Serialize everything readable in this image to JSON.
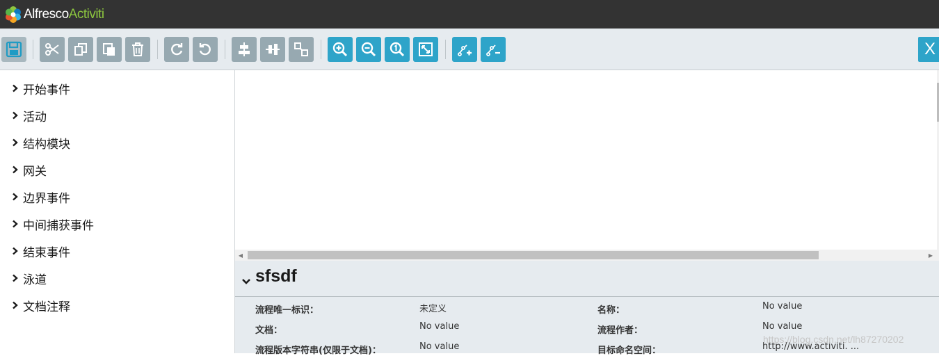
{
  "header": {
    "brand": "Alfresco",
    "product": "Activiti"
  },
  "toolbar": {
    "buttons": [
      {
        "icon": "save-icon",
        "style": "gray-light"
      },
      {
        "icon": "cut-icon",
        "style": "gray"
      },
      {
        "icon": "copy-icon",
        "style": "gray"
      },
      {
        "icon": "paste-icon",
        "style": "gray"
      },
      {
        "icon": "delete-icon",
        "style": "gray"
      },
      {
        "icon": "redo-icon",
        "style": "gray"
      },
      {
        "icon": "undo-icon",
        "style": "gray"
      },
      {
        "icon": "align-vertical-icon",
        "style": "gray"
      },
      {
        "icon": "align-horizontal-icon",
        "style": "gray"
      },
      {
        "icon": "same-size-icon",
        "style": "gray"
      },
      {
        "icon": "zoom-in-icon",
        "style": "blue"
      },
      {
        "icon": "zoom-out-icon",
        "style": "blue"
      },
      {
        "icon": "zoom-actual-icon",
        "style": "blue"
      },
      {
        "icon": "zoom-fit-icon",
        "style": "blue"
      },
      {
        "icon": "add-bendpoint-icon",
        "style": "blue"
      },
      {
        "icon": "remove-bendpoint-icon",
        "style": "blue"
      }
    ],
    "close_label": "X"
  },
  "palette": {
    "items": [
      "开始事件",
      "活动",
      "结构模块",
      "网关",
      "边界事件",
      "中间捕获事件",
      "结束事件",
      "泳道",
      "文档注释"
    ]
  },
  "properties": {
    "title": "sfsdf",
    "rows": [
      {
        "label": "流程唯一标识：",
        "value": "未定义",
        "label2": "名称：",
        "value2": "No value"
      },
      {
        "label": "文档：",
        "value": "No value",
        "label2": "流程作者：",
        "value2": "No value"
      },
      {
        "label": "流程版本字符串(仅限于文档)：",
        "value": "No value",
        "label2": "目标命名空间：",
        "value2": "http://www.activiti. ..."
      }
    ]
  },
  "watermark": "https://blog.csdn.net/lh87270202",
  "colors": {
    "topbar": "#333333",
    "toolbar_bg": "#e6ebef",
    "button_gray": "#97a9b1",
    "button_blue": "#2ea4c9",
    "brand_green": "#8dc63f"
  }
}
